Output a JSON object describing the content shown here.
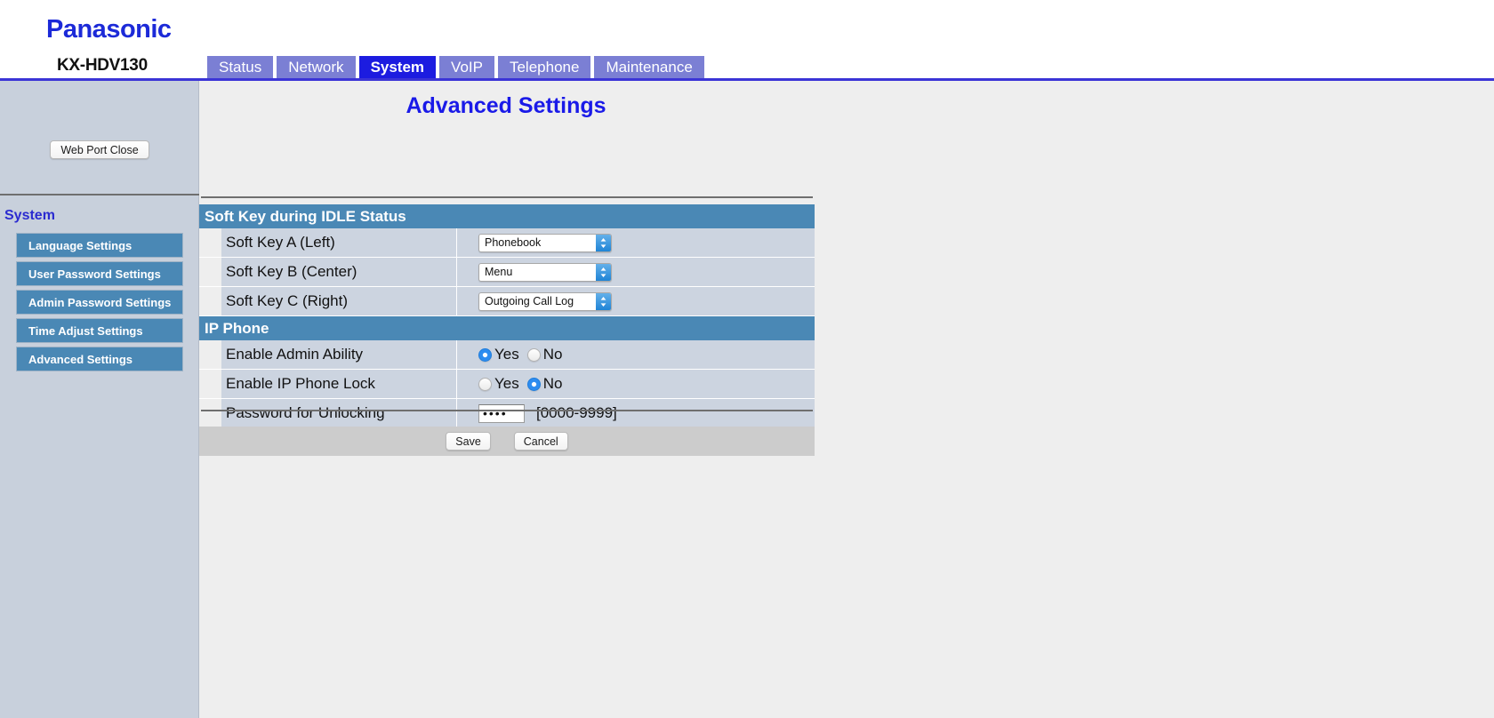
{
  "brand": {
    "logo_text": "Panasonic",
    "model": "KX-HDV130",
    "logo_color": "#1c2ad8"
  },
  "tabs": [
    {
      "label": "Status",
      "active": false
    },
    {
      "label": "Network",
      "active": false
    },
    {
      "label": "System",
      "active": true
    },
    {
      "label": "VoIP",
      "active": false
    },
    {
      "label": "Telephone",
      "active": false
    },
    {
      "label": "Maintenance",
      "active": false
    }
  ],
  "tab_colors": {
    "inactive_bg": "#7b7fd4",
    "active_bg": "#1c1ce0",
    "underline": "#3b34d6"
  },
  "sidebar": {
    "web_port_close_label": "Web Port Close",
    "heading": "System",
    "items": [
      {
        "label": "Language Settings"
      },
      {
        "label": "User Password Settings"
      },
      {
        "label": "Admin Password Settings"
      },
      {
        "label": "Time Adjust Settings"
      },
      {
        "label": "Advanced Settings"
      }
    ],
    "item_bg": "#4a88b5",
    "bg": "#c8d0dc"
  },
  "main": {
    "page_title": "Advanced Settings",
    "title_color": "#1a1ae8",
    "sections": [
      {
        "header": "Soft Key during IDLE Status",
        "rows": [
          {
            "label": "Soft Key A (Left)",
            "type": "select",
            "value": "Phonebook"
          },
          {
            "label": "Soft Key B (Center)",
            "type": "select",
            "value": "Menu"
          },
          {
            "label": "Soft Key C (Right)",
            "type": "select",
            "value": "Outgoing Call Log"
          }
        ]
      },
      {
        "header": "IP Phone",
        "rows": [
          {
            "label": "Enable Admin Ability",
            "type": "radio",
            "options": [
              "Yes",
              "No"
            ],
            "selected": "Yes"
          },
          {
            "label": "Enable IP Phone Lock",
            "type": "radio",
            "options": [
              "Yes",
              "No"
            ],
            "selected": "No"
          },
          {
            "label": "Password for Unlocking",
            "type": "password",
            "value": "••••",
            "hint": "[0000-9999]"
          }
        ]
      }
    ],
    "buttons": {
      "save_label": "Save",
      "cancel_label": "Cancel"
    },
    "section_header_bg": "#4a88b5",
    "row_bg": "#ccd4e0"
  }
}
